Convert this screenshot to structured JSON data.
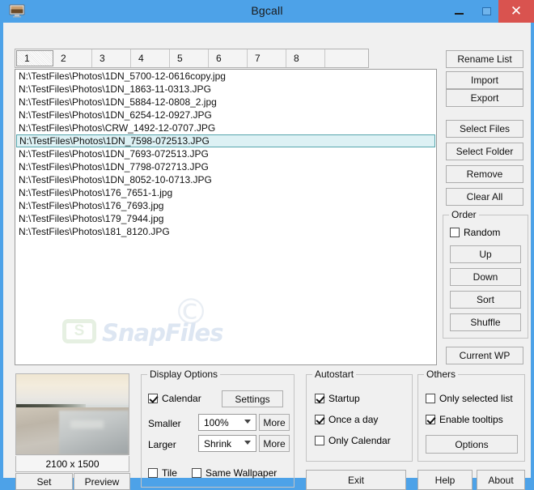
{
  "window": {
    "title": "Bgcall",
    "icon": "monitor-icon",
    "controls": {
      "minimize": "minimize-icon",
      "maximize": "maximize-icon",
      "close": "close-icon"
    },
    "close_color": "#d9534f",
    "titlebar_color": "#4da2e8"
  },
  "tabs": {
    "items": [
      "1",
      "2",
      "3",
      "4",
      "5",
      "6",
      "7",
      "8"
    ],
    "selected_index": 0
  },
  "file_list": {
    "items": [
      "N:\\TestFiles\\Photos\\1DN_5700-12-0616copy.jpg",
      "N:\\TestFiles\\Photos\\1DN_1863-11-0313.JPG",
      "N:\\TestFiles\\Photos\\1DN_5884-12-0808_2.jpg",
      "N:\\TestFiles\\Photos\\1DN_6254-12-0927.JPG",
      "N:\\TestFiles\\Photos\\CRW_1492-12-0707.JPG",
      "N:\\TestFiles\\Photos\\1DN_7598-072513.JPG",
      "N:\\TestFiles\\Photos\\1DN_7693-072513.JPG",
      "N:\\TestFiles\\Photos\\1DN_7798-072713.JPG",
      "N:\\TestFiles\\Photos\\1DN_8052-10-0713.JPG",
      "N:\\TestFiles\\Photos\\176_7651-1.jpg",
      "N:\\TestFiles\\Photos\\176_7693.jpg",
      "N:\\TestFiles\\Photos\\179_7944.jpg",
      "N:\\TestFiles\\Photos\\181_8120.JPG"
    ],
    "selected_index": 5,
    "selection_color": "#ddf1f4"
  },
  "watermark": {
    "copyright": "©",
    "logo": "S",
    "text": "SnapFiles"
  },
  "right_buttons": {
    "rename_list": "Rename List",
    "import": "Import",
    "export": "Export",
    "select_files": "Select Files",
    "select_folder": "Select Folder",
    "remove": "Remove",
    "clear_all": "Clear All",
    "current_wp": "Current WP"
  },
  "order_group": {
    "title": "Order",
    "random_label": "Random",
    "random_checked": false,
    "up": "Up",
    "down": "Down",
    "sort": "Sort",
    "shuffle": "Shuffle"
  },
  "preview": {
    "dimensions": "2100 x 1500",
    "set": "Set",
    "preview": "Preview",
    "image": "beach-sunset-thumbnail"
  },
  "display_options": {
    "title": "Display Options",
    "calendar_label": "Calendar",
    "calendar_checked": true,
    "settings": "Settings",
    "smaller_label": "Smaller",
    "smaller_value": "100%",
    "smaller_more": "More",
    "larger_label": "Larger",
    "larger_value": "Shrink",
    "larger_more": "More",
    "tile_label": "Tile",
    "tile_checked": false,
    "same_wallpaper_label": "Same Wallpaper",
    "same_wallpaper_checked": false
  },
  "autostart": {
    "title": "Autostart",
    "startup_label": "Startup",
    "startup_checked": true,
    "once_a_day_label": "Once a day",
    "once_a_day_checked": true,
    "only_calendar_label": "Only Calendar",
    "only_calendar_checked": false
  },
  "others": {
    "title": "Others",
    "only_selected_list_label": "Only selected list",
    "only_selected_list_checked": false,
    "enable_tooltips_label": "Enable tooltips",
    "enable_tooltips_checked": true,
    "options": "Options"
  },
  "bottom_buttons": {
    "exit": "Exit",
    "help": "Help",
    "about": "About"
  }
}
